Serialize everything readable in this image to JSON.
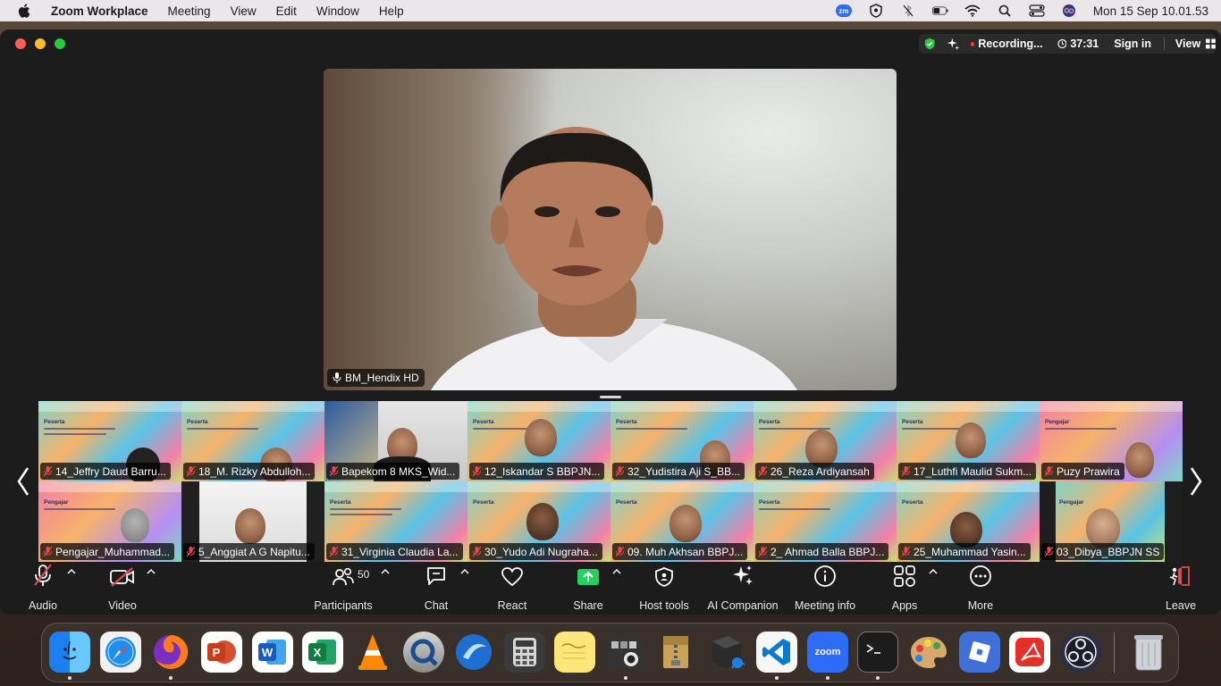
{
  "menubar": {
    "app_name": "Zoom Workplace",
    "menus": [
      "Meeting",
      "View",
      "Edit",
      "Window",
      "Help"
    ],
    "zoom_badge": "zm",
    "clock": "Mon 15 Sep  10.01.53"
  },
  "status": {
    "recording": "Recording...",
    "timer": "37:31",
    "sign_in": "Sign in",
    "view": "View"
  },
  "speaker": {
    "name": "BM_Hendix HD"
  },
  "gallery": {
    "tiles": [
      {
        "name": "14_Jeffry Daud Barru..."
      },
      {
        "name": "18_M. Rizky Abdulloh..."
      },
      {
        "name": "Bapekom 8 MKS_Wid..."
      },
      {
        "name": "12_Iskandar S BBPJN..."
      },
      {
        "name": "32_Yudistira Aji S_BB..."
      },
      {
        "name": "26_Reza Ardiyansah"
      },
      {
        "name": "17_Luthfi Maulid Sukm..."
      },
      {
        "name": "Puzy Prawira"
      },
      {
        "name": "Pengajar_Muhammad..."
      },
      {
        "name": "5_Anggiat A G Napitu..."
      },
      {
        "name": "31_Virginia Claudia La..."
      },
      {
        "name": "30_Yudo Adi Nugraha..."
      },
      {
        "name": "09. Muh Akhsan BBPJ..."
      },
      {
        "name": "2_ Ahmad Balla BBPJ..."
      },
      {
        "name": "25_Muhammad Yasin..."
      },
      {
        "name": "03_Dibya_BBPJN SS"
      }
    ],
    "slide_peserta": "Peserta",
    "slide_pengajar": "Pengajar"
  },
  "toolbar": {
    "audio": "Audio",
    "video": "Video",
    "participants": "Participants",
    "participants_count": "50",
    "chat": "Chat",
    "react": "React",
    "share": "Share",
    "host_tools": "Host tools",
    "ai_companion": "AI Companion",
    "meeting_info": "Meeting info",
    "apps": "Apps",
    "more": "More",
    "leave": "Leave"
  },
  "dock": {
    "zoom_label": "zoom",
    "apps": [
      "finder-icon",
      "safari-icon",
      "firefox-icon",
      "powerpoint-icon",
      "word-icon",
      "excel-icon",
      "vlc-icon",
      "quicktime-icon",
      "wing-icon",
      "calculator-icon",
      "stickies-icon",
      "photo-booth-icon",
      "archive-utility-icon",
      "server-icon",
      "vscode-icon",
      "zoom-icon",
      "terminal-icon",
      "color-palette-icon",
      "roblox-icon",
      "acrobat-icon",
      "obs-icon",
      "trash-icon"
    ]
  },
  "colors": {
    "accent_green": "#28c840",
    "recording_red": "#ff3b30",
    "mute_red": "#e5484d",
    "share_green": "#23d160",
    "zoom_blue": "#2d6cf6"
  }
}
